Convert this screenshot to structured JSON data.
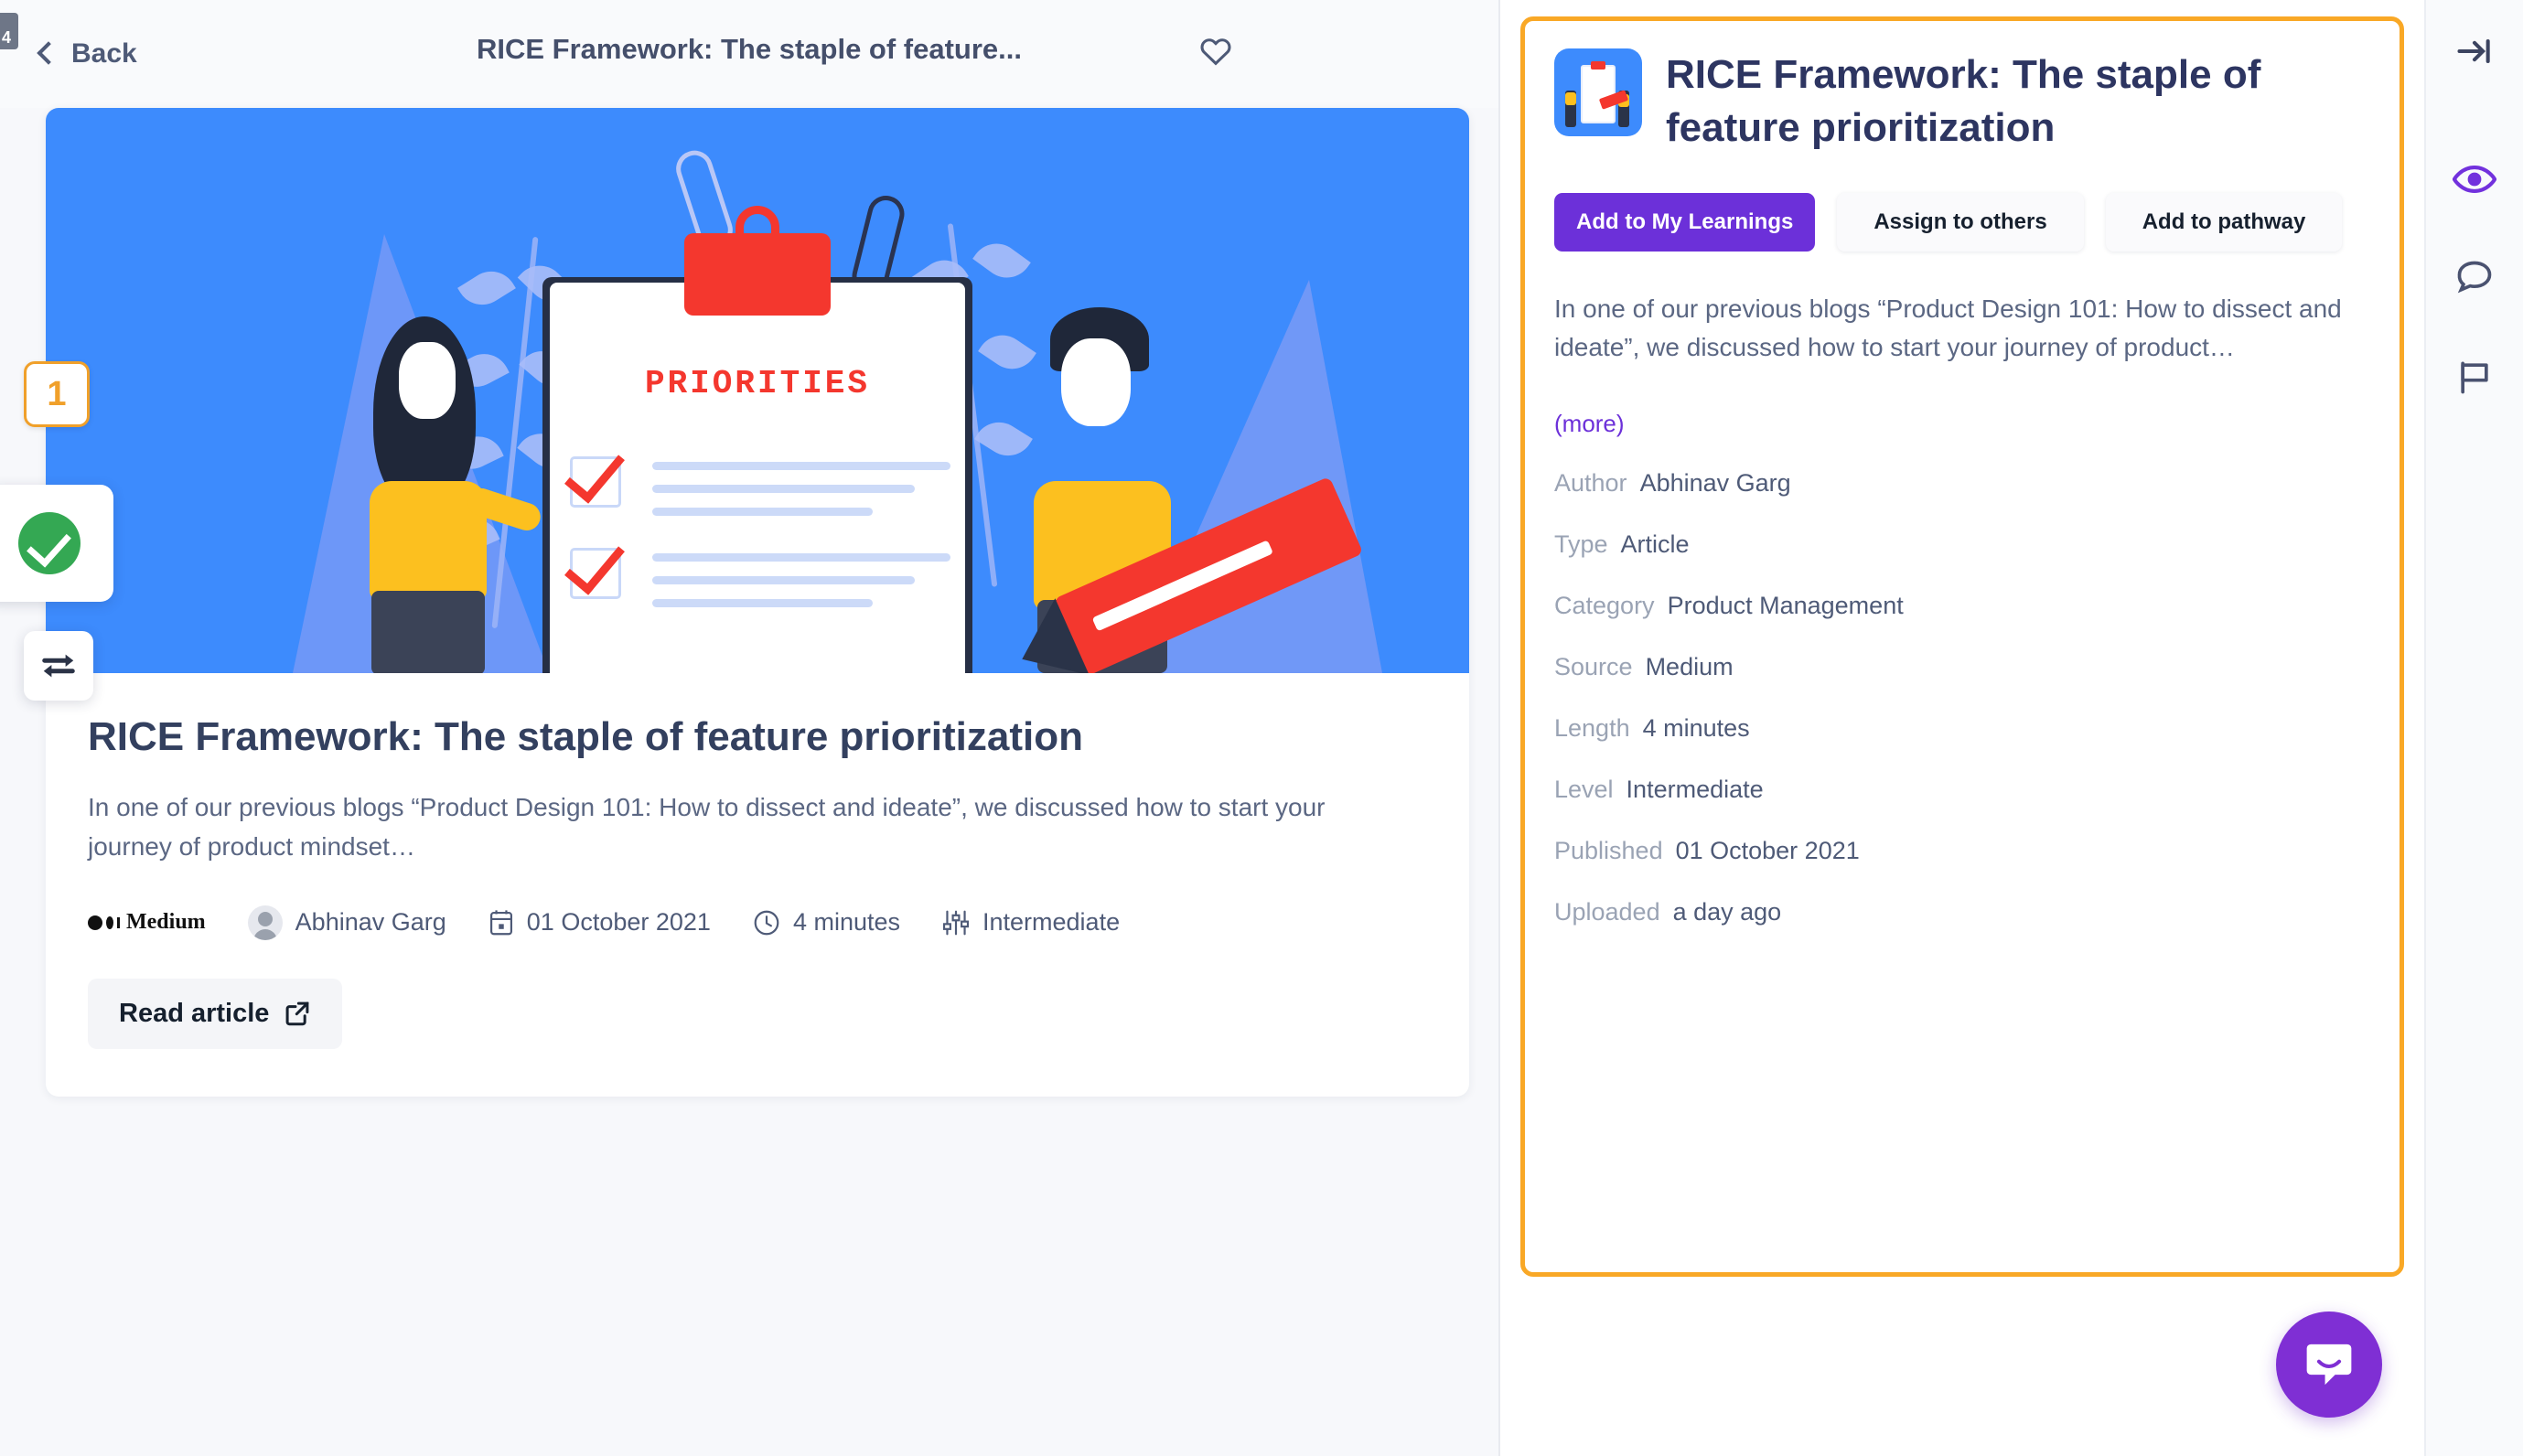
{
  "topbar": {
    "back_label": "Back",
    "title": "RICE Framework: The staple of feature...",
    "favorite_icon": "heart-icon",
    "corner_badge": "4"
  },
  "left_widgets": {
    "step_number": "1",
    "check_icon": "check-circle-icon",
    "swap_icon": "swap-arrows-icon"
  },
  "card": {
    "hero_illustration_label": "PRIORITIES",
    "title": "RICE Framework: The staple of feature prioritization",
    "description": "In one of our previous blogs “Product Design 101: How to dissect and ideate”, we discussed how to start your journey of product mindset…",
    "source_label": "Medium",
    "author": "Abhinav Garg",
    "date": "01 October 2021",
    "duration": "4 minutes",
    "level": "Intermediate",
    "read_button": "Read article",
    "read_button_icon": "external-link-icon"
  },
  "detail": {
    "title": "RICE Framework: The staple of feature prioritization",
    "thumbnail_icon": "article-thumbnail",
    "buttons": {
      "primary": "Add to My Learnings",
      "assign": "Assign to others",
      "pathway": "Add to pathway"
    },
    "description": "In one of our previous blogs “Product Design 101: How to dissect and ideate”, we discussed how to start your journey of product…",
    "more_link": "(more)",
    "specs": [
      {
        "key": "Author",
        "value": "Abhinav Garg"
      },
      {
        "key": "Type",
        "value": "Article"
      },
      {
        "key": "Category",
        "value": "Product Management"
      },
      {
        "key": "Source",
        "value": "Medium"
      },
      {
        "key": "Length",
        "value": "4 minutes"
      },
      {
        "key": "Level",
        "value": "Intermediate"
      },
      {
        "key": "Published",
        "value": "01 October 2021"
      },
      {
        "key": "Uploaded",
        "value": "a day ago"
      }
    ]
  },
  "rail": {
    "icons": [
      "collapse-right-icon",
      "eye-icon",
      "comment-icon",
      "flag-icon"
    ]
  },
  "chat": {
    "icon": "intercom-chat-icon"
  },
  "colors": {
    "accent_purple": "#6c30d9",
    "highlight_orange": "#f9a826",
    "hero_blue": "#3d8bfd",
    "success_green": "#34a853",
    "text_dark": "#2d3561",
    "text_muted": "#9aa3b4"
  }
}
